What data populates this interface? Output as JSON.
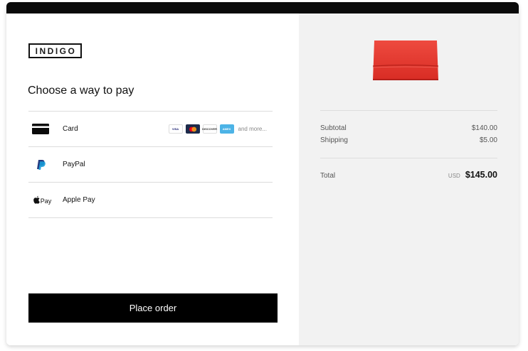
{
  "brand": {
    "logo_text": "INDIGO"
  },
  "checkout": {
    "heading": "Choose a way to pay",
    "methods": [
      {
        "id": "card",
        "label": "Card",
        "icon": "credit-card-icon"
      },
      {
        "id": "paypal",
        "label": "PayPal",
        "icon": "paypal-icon"
      },
      {
        "id": "applepay",
        "label": "Apple Pay",
        "icon": "apple-pay-icon"
      }
    ],
    "card_brands": [
      "VISA",
      "",
      "DISCOVER",
      "AMEX"
    ],
    "card_more": "and more...",
    "place_order_label": "Place order"
  },
  "summary": {
    "product_color": "#e8382f",
    "subtotal_label": "Subtotal",
    "subtotal_value": "$140.00",
    "shipping_label": "Shipping",
    "shipping_value": "$5.00",
    "total_label": "Total",
    "currency": "USD",
    "total_value": "$145.00"
  },
  "colors": {
    "accent": "#000000",
    "sidebar_bg": "#f2f2f2",
    "divider": "#dcdcdc"
  }
}
